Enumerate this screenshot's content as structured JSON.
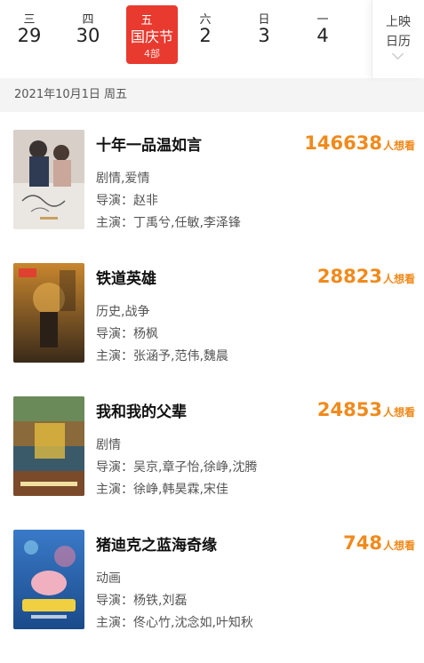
{
  "datebar": {
    "days": [
      {
        "weekday": "三",
        "date": "29"
      },
      {
        "weekday": "四",
        "date": "30"
      },
      {
        "weekday": "五",
        "name": "国庆节",
        "count": "4部"
      },
      {
        "weekday": "六",
        "date": "2"
      },
      {
        "weekday": "日",
        "date": "3"
      },
      {
        "weekday": "一",
        "date": "4"
      }
    ],
    "calendar_line1": "上映",
    "calendar_line2": "日历"
  },
  "date_header": "2021年10月1日 周五",
  "wish_unit": "人想看",
  "movies": [
    {
      "title": "十年一品温如言",
      "wish": "146638",
      "genre": "剧情,爱情",
      "director": "导演：赵非",
      "cast": "主演：丁禹兮,任敏,李泽锋"
    },
    {
      "title": "铁道英雄",
      "wish": "28823",
      "genre": "历史,战争",
      "director": "导演：杨枫",
      "cast": "主演：张涵予,范伟,魏晨"
    },
    {
      "title": "我和我的父辈",
      "wish": "24853",
      "genre": "剧情",
      "director": "导演：吴京,章子怡,徐峥,沈腾",
      "cast": "主演：徐峥,韩昊霖,宋佳"
    },
    {
      "title": "猪迪克之蓝海奇缘",
      "wish": "748",
      "genre": "动画",
      "director": "导演：杨铁,刘磊",
      "cast": "主演：佟心竹,沈念如,叶知秋"
    }
  ],
  "colors": {
    "accent": "#e83a2f",
    "wish": "#f08a1c"
  }
}
